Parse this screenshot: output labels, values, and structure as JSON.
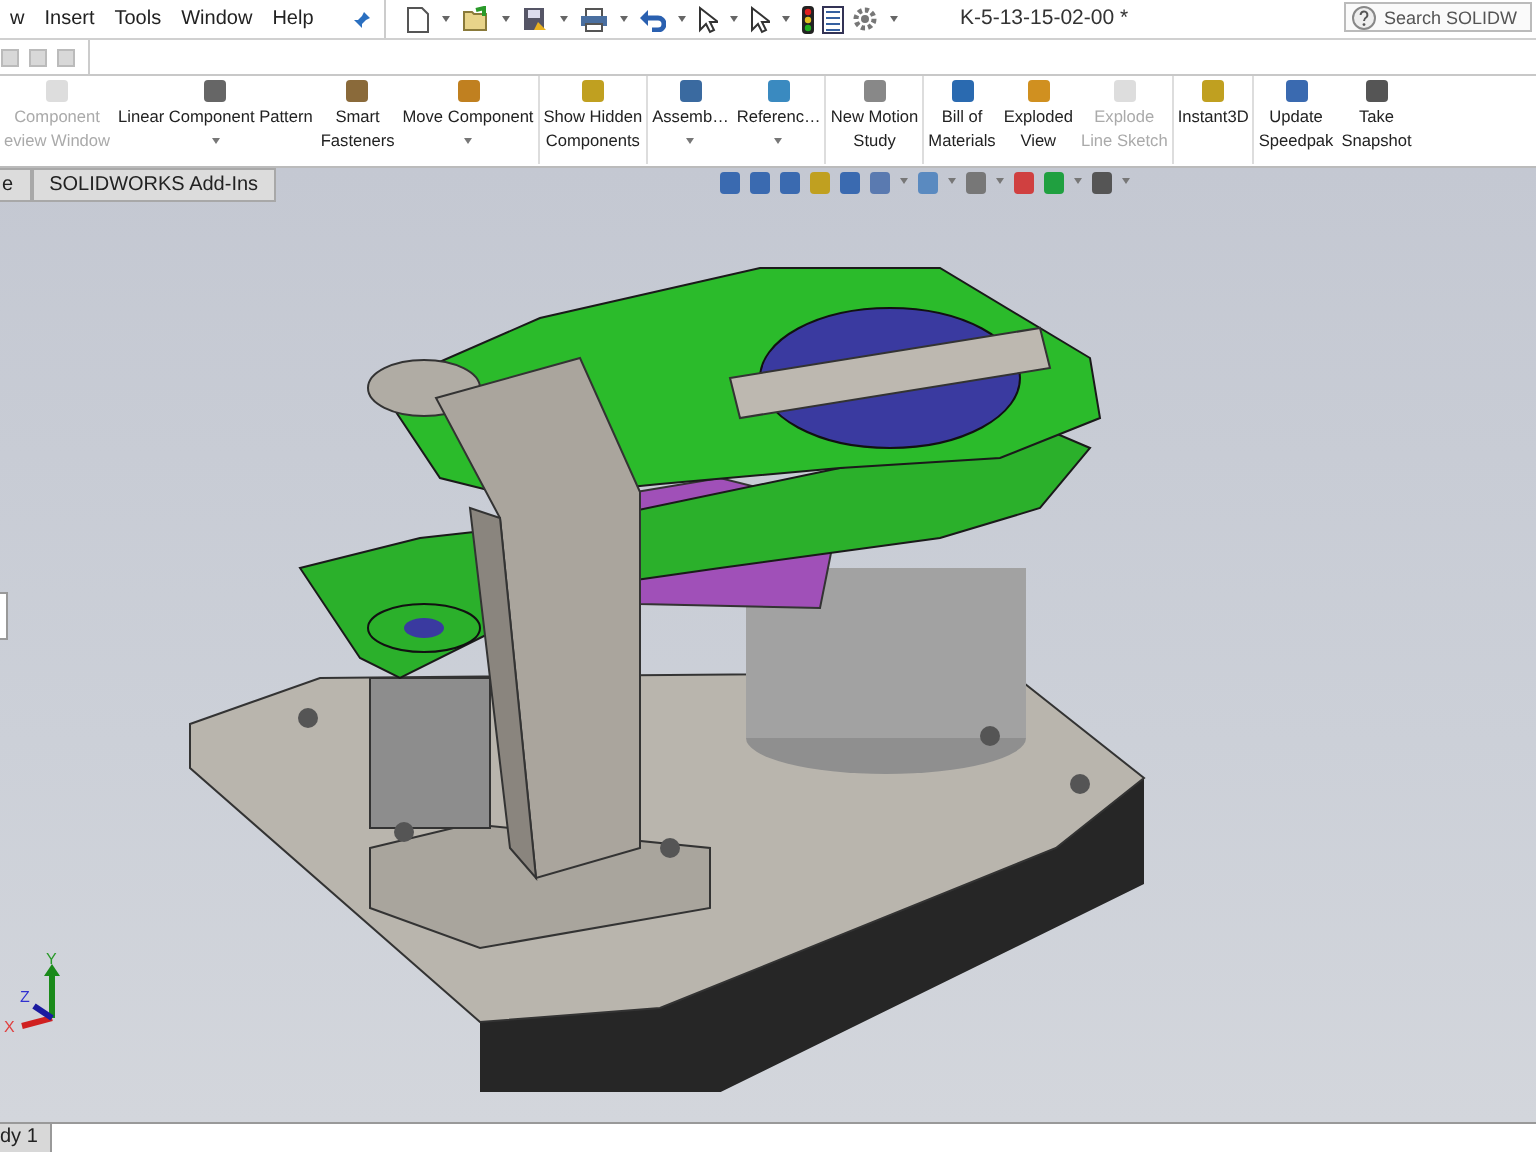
{
  "menu": [
    "w",
    "Insert",
    "Tools",
    "Window",
    "Help"
  ],
  "window": {
    "title": "K-5-13-15-02-00 *"
  },
  "search": {
    "placeholder": "Search SOLIDW"
  },
  "commands": [
    {
      "lines": [
        "Component",
        "eview Window"
      ],
      "disabled": true,
      "dropdown": false
    },
    {
      "lines": [
        "Linear Component Pattern"
      ],
      "disabled": false,
      "dropdown": true
    },
    {
      "lines": [
        "Smart",
        "Fasteners"
      ],
      "disabled": false,
      "dropdown": false
    },
    {
      "lines": [
        "Move Component"
      ],
      "disabled": false,
      "dropdown": true
    },
    {
      "lines": [
        "Show Hidden",
        "Components"
      ],
      "disabled": false,
      "dropdown": false,
      "separator": true
    },
    {
      "lines": [
        "Assemb…"
      ],
      "disabled": false,
      "dropdown": true,
      "separator": true
    },
    {
      "lines": [
        "Referenc…"
      ],
      "disabled": false,
      "dropdown": true
    },
    {
      "lines": [
        "New Motion",
        "Study"
      ],
      "disabled": false,
      "dropdown": false,
      "separator": true
    },
    {
      "lines": [
        "Bill of",
        "Materials"
      ],
      "disabled": false,
      "dropdown": false,
      "separator": true
    },
    {
      "lines": [
        "Exploded",
        "View"
      ],
      "disabled": false,
      "dropdown": false
    },
    {
      "lines": [
        "Explode",
        "Line Sketch"
      ],
      "disabled": true,
      "dropdown": false
    },
    {
      "lines": [
        "Instant3D"
      ],
      "disabled": false,
      "dropdown": false,
      "separator": true
    },
    {
      "lines": [
        "Update",
        "Speedpak"
      ],
      "disabled": false,
      "dropdown": false,
      "separator": true
    },
    {
      "lines": [
        "Take",
        "Snapshot"
      ],
      "disabled": false,
      "dropdown": false
    }
  ],
  "tabs": [
    {
      "label": "e",
      "selected": false
    },
    {
      "label": "SOLIDWORKS Add-Ins",
      "selected": false
    }
  ],
  "triad": {
    "x": "X",
    "y": "Y",
    "z": "Z"
  },
  "bottom_tabs": [
    {
      "label": "dy 1",
      "selected": true
    }
  ]
}
